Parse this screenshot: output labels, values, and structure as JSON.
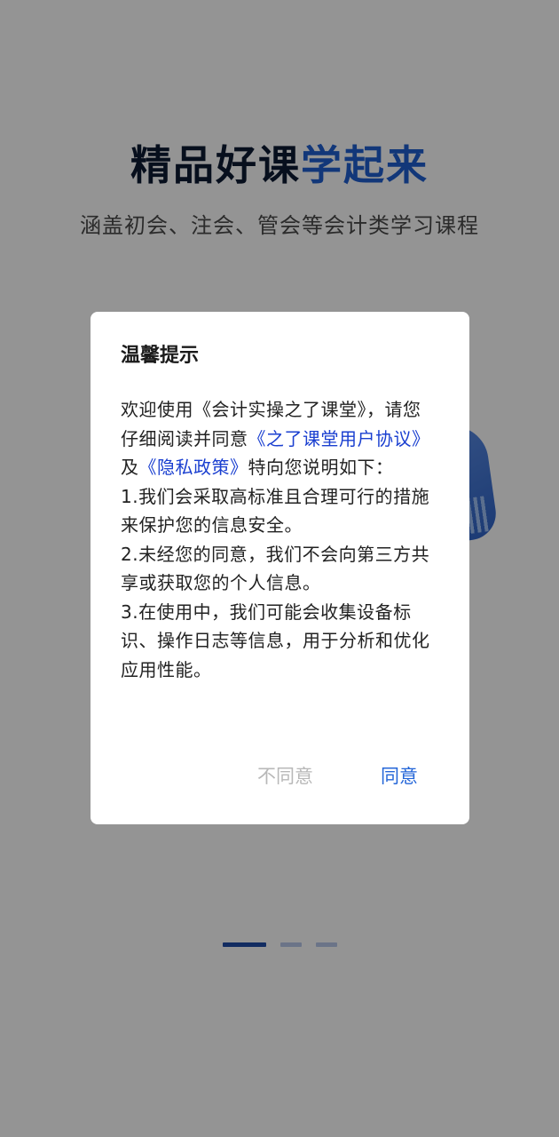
{
  "background": {
    "headline_dark": "精品好课",
    "headline_accent": "学起来",
    "subtitle": "涵盖初会、注会、管会等会计类学习课程",
    "colors": {
      "headline_dark": "#0d1a33",
      "headline_accent": "#1f5fd1",
      "pager_active": "#1f4ca8"
    },
    "pager": {
      "count": 3,
      "active_index": 0
    }
  },
  "dialog": {
    "title": "温馨提示",
    "intro_1": "欢迎使用《会计实操之了课堂》，请您仔细阅读并同意",
    "link_user_agreement": "《之了课堂用户协议》",
    "intro_2": "及",
    "link_privacy_policy": "《隐私政策》",
    "intro_3": "特向您说明如下：",
    "item_1": "1.我们会采取高标准且合理可行的措施来保护您的信息安全。",
    "item_2": "2.未经您的同意，我们不会向第三方共享或获取您的个人信息。",
    "item_3": "3.在使用中，我们可能会收集设备标识、操作日志等信息，用于分析和优化应用性能。",
    "decline_label": "不同意",
    "agree_label": "同意",
    "colors": {
      "link": "#1a3fd0",
      "agree": "#2466d8",
      "decline": "#b8b8b8"
    }
  }
}
